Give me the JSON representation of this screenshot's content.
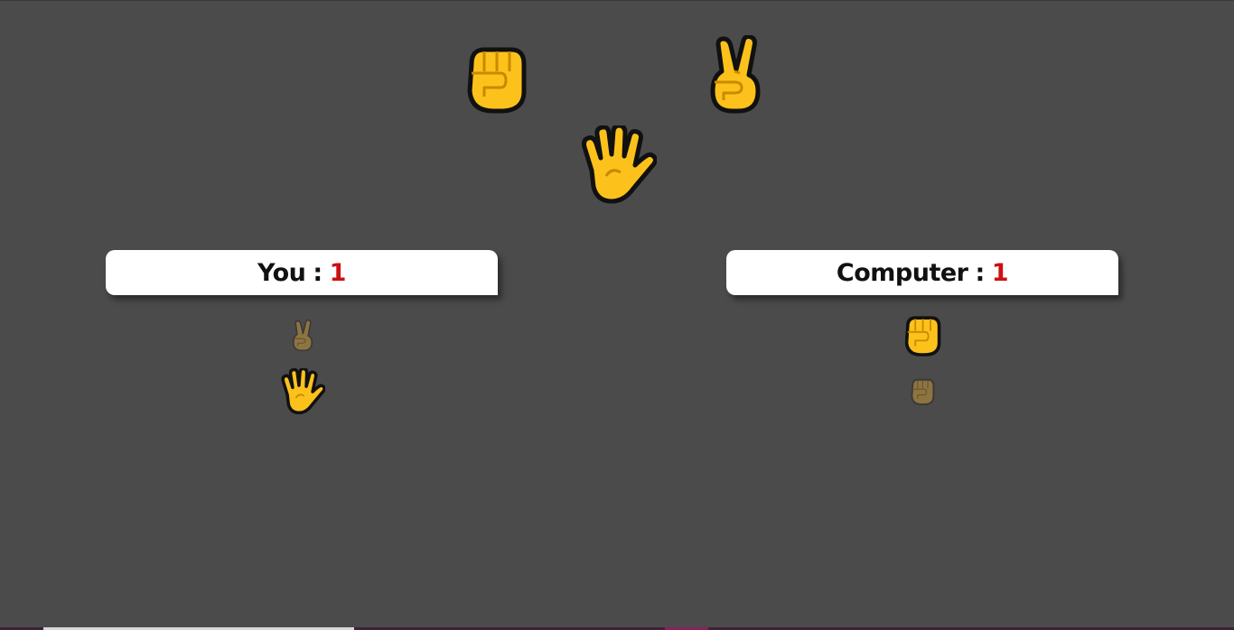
{
  "choices": [
    {
      "id": "rock",
      "icon": "raised-fist-icon"
    },
    {
      "id": "scissors",
      "icon": "victory-hand-icon"
    },
    {
      "id": "paper",
      "icon": "raised-hand-icon"
    }
  ],
  "player": {
    "label": "You",
    "separator": ":",
    "score": "1",
    "history": [
      {
        "icon": "victory-hand-icon",
        "state": "faded"
      },
      {
        "icon": "raised-hand-icon",
        "state": "winner"
      }
    ]
  },
  "computer": {
    "label": "Computer",
    "separator": ":",
    "score": "1",
    "history": [
      {
        "icon": "raised-fist-icon",
        "state": "winner"
      },
      {
        "icon": "raised-fist-icon",
        "state": "faded"
      }
    ]
  },
  "colors": {
    "background": "#4b4b4b",
    "score_accent": "#cc1111",
    "emoji_yellow": "#fcc21b",
    "emoji_faded": "#8e7440"
  }
}
